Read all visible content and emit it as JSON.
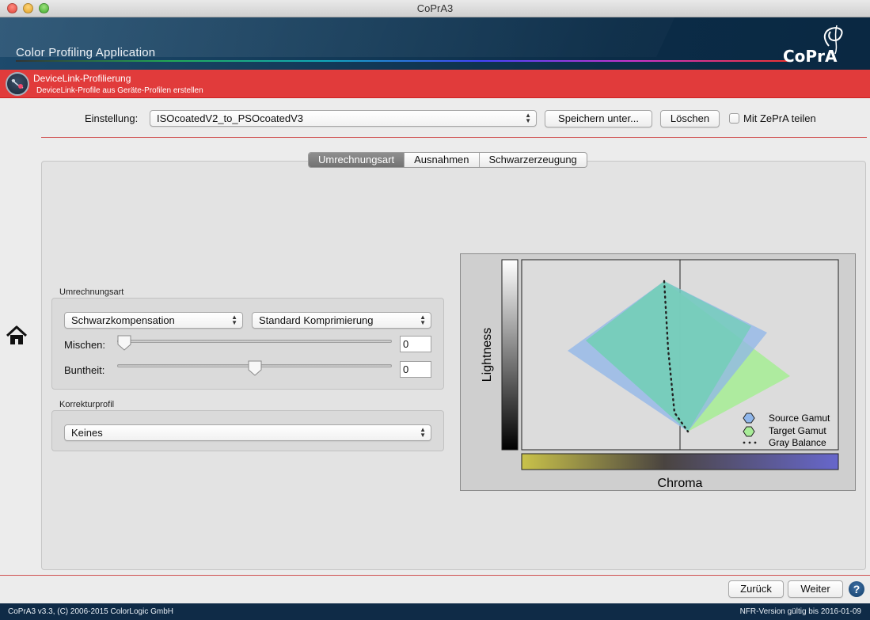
{
  "window": {
    "title": "CoPrA3"
  },
  "header": {
    "app_title": "Color Profiling Application",
    "logo_text": "CoPrA"
  },
  "module": {
    "title": "DeviceLink-Profilierung",
    "subtitle": "DeviceLink-Profile aus Geräte-Profilen erstellen"
  },
  "settings": {
    "label": "Einstellung:",
    "selected": "ISOcoatedV2_to_PSOcoatedV3",
    "save_button": "Speichern unter...",
    "delete_button": "Löschen",
    "share_label": "Mit ZePrA teilen",
    "share_checked": false
  },
  "tabs": [
    {
      "label": "Umrechnungsart",
      "active": true
    },
    {
      "label": "Ausnahmen",
      "active": false
    },
    {
      "label": "Schwarzerzeugung",
      "active": false
    }
  ],
  "conversion": {
    "group_title": "Umrechnungsart",
    "mode_select": "Schwarzkompensation",
    "compression_select": "Standard Komprimierung",
    "mix_label": "Mischen:",
    "mix_value": "0",
    "mix_fraction": 0.0,
    "chroma_label": "Buntheit:",
    "chroma_value": "0",
    "chroma_fraction": 0.5
  },
  "correction": {
    "group_title": "Korrekturprofil",
    "selected": "Keines"
  },
  "gamut_chart": {
    "y_label": "Lightness",
    "x_label": "Chroma",
    "legend": [
      {
        "label": "Source Gamut",
        "color": "#8fb6ea"
      },
      {
        "label": "Target Gamut",
        "color": "#a8ec98"
      },
      {
        "label": "Gray Balance",
        "color": "#222222"
      }
    ]
  },
  "footer": {
    "back_button": "Zurück",
    "next_button": "Weiter",
    "help_glyph": "?",
    "copyright": "CoPrA3 v3.3, (C) 2006-2015 ColorLogic GmbH",
    "license": "NFR-Version gültig bis 2016-01-09"
  },
  "colors": {
    "module_bar": "#e13b3b",
    "banner": "#0b2c47",
    "statusbar": "#0f2b47"
  }
}
